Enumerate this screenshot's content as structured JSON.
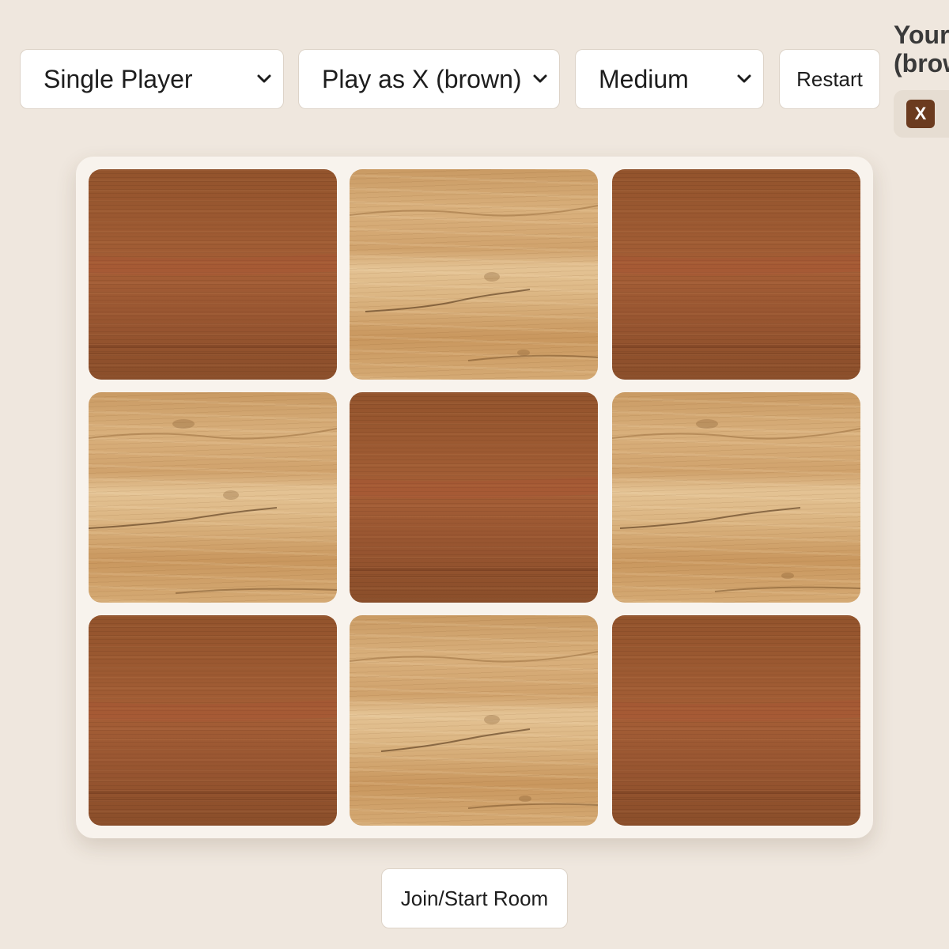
{
  "controls": {
    "mode": {
      "selected": "Single Player"
    },
    "player": {
      "selected": "Play as X (brown)"
    },
    "difficulty": {
      "selected": "Medium"
    },
    "restart_label": "Restart"
  },
  "status": {
    "title_line1": "Your",
    "title_line2": "(brow",
    "current_mark": "X"
  },
  "board": {
    "cells": [
      {
        "mark": "",
        "texture": "dark-wood"
      },
      {
        "mark": "",
        "texture": "light-wood"
      },
      {
        "mark": "",
        "texture": "dark-wood"
      },
      {
        "mark": "",
        "texture": "light-wood"
      },
      {
        "mark": "",
        "texture": "dark-wood"
      },
      {
        "mark": "",
        "texture": "light-wood"
      },
      {
        "mark": "",
        "texture": "dark-wood"
      },
      {
        "mark": "",
        "texture": "light-wood"
      },
      {
        "mark": "",
        "texture": "dark-wood"
      }
    ]
  },
  "room_label": "Join/Start Room",
  "colors": {
    "background": "#efe7de",
    "board_frame": "#f8f3ed",
    "x_mark": "#6b3b1f"
  },
  "icons": {
    "select_arrow": "chevron-down-icon"
  }
}
